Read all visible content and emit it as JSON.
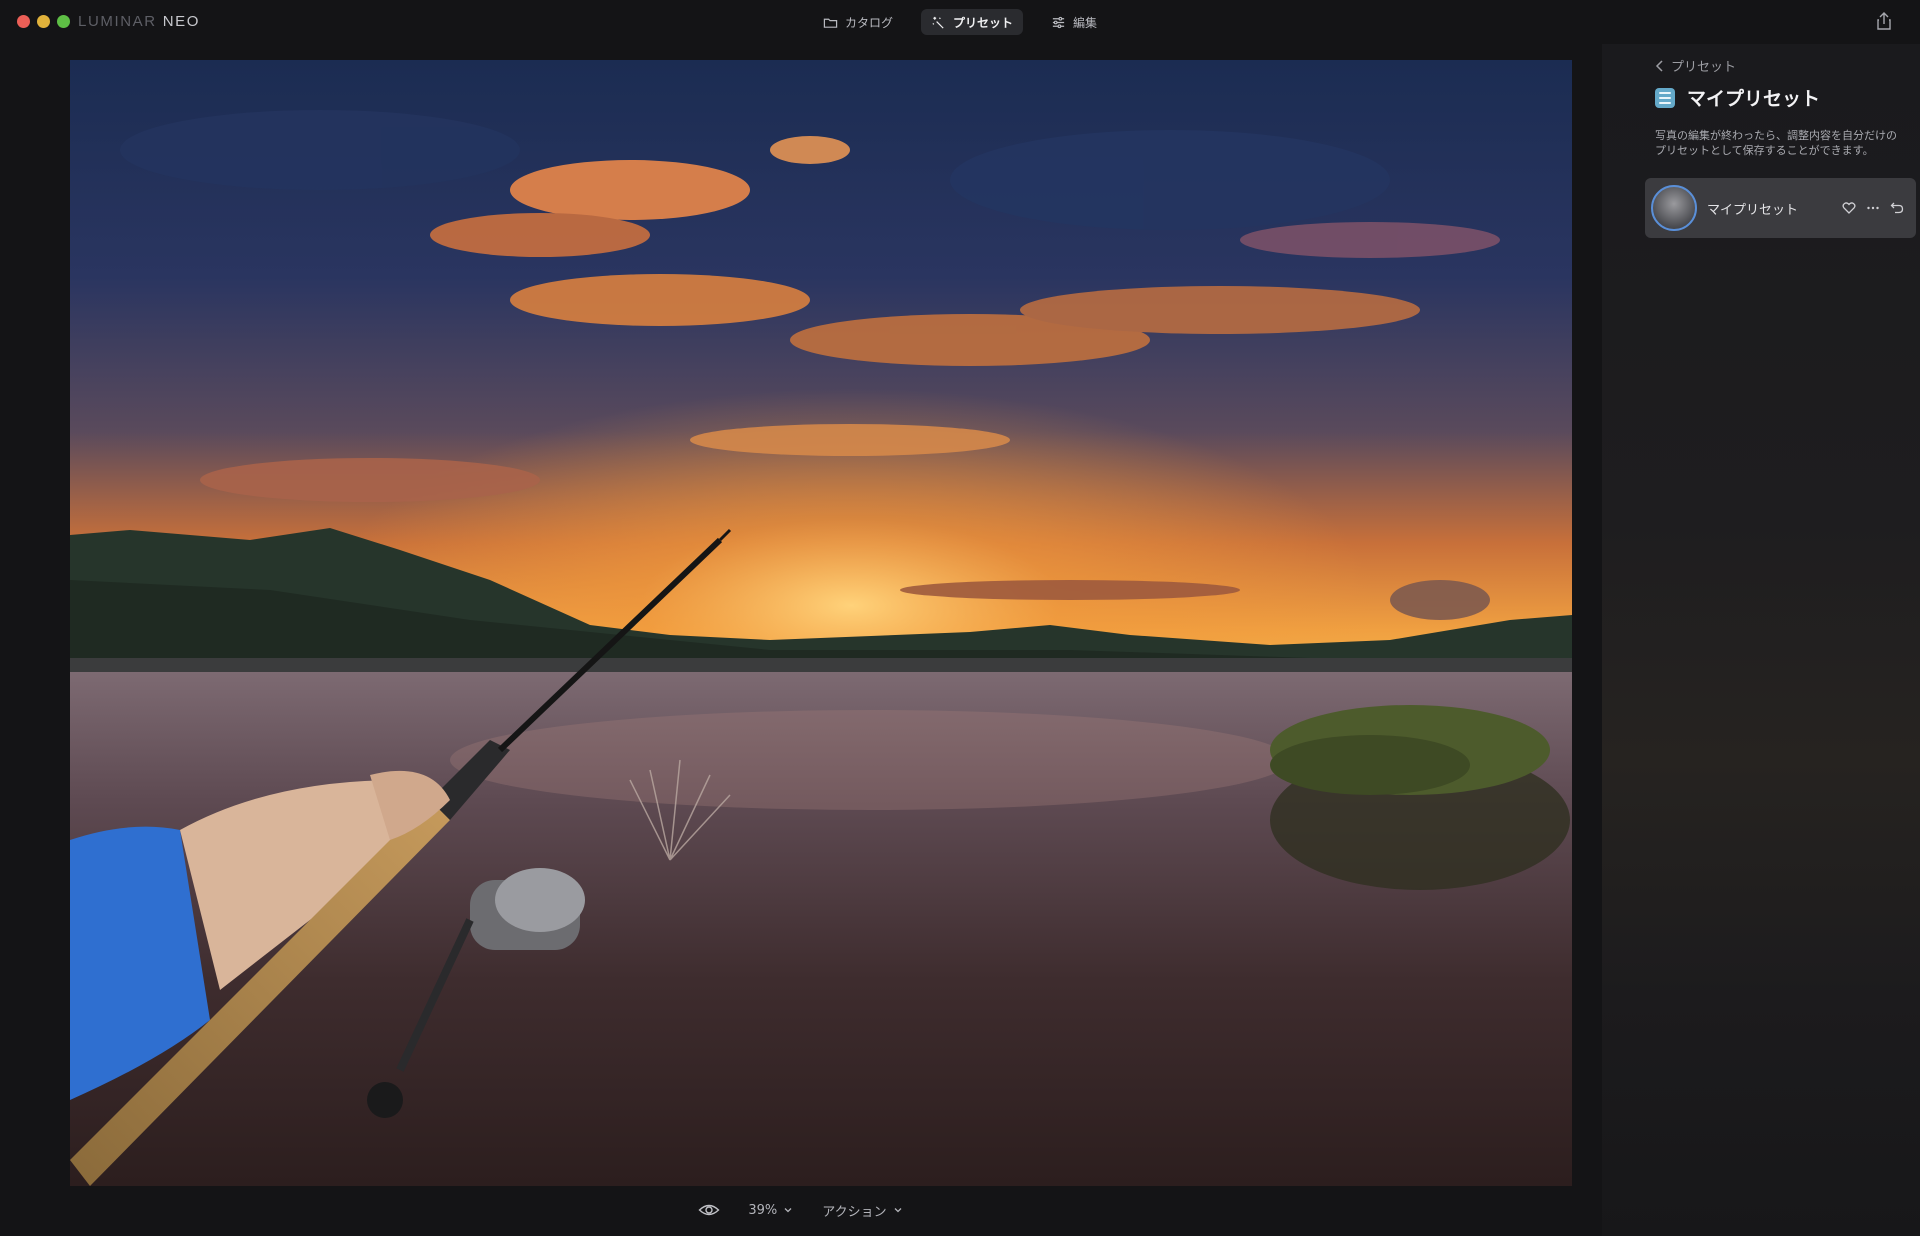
{
  "app": {
    "brand": "LUMINAR",
    "brand_suffix": "NEO"
  },
  "nav": {
    "tabs": [
      {
        "label": "カタログ",
        "icon": "folder-icon",
        "active": false
      },
      {
        "label": "プリセット",
        "icon": "magic-wand-icon",
        "active": true
      },
      {
        "label": "編集",
        "icon": "sliders-icon",
        "active": false
      }
    ]
  },
  "toolbar": {
    "zoom": "39%",
    "actions_label": "アクション"
  },
  "panel": {
    "back_label": "プリセット",
    "title": "マイプリセット",
    "description": "写真の編集が終わったら、調整内容を自分だけのプリセットとして保存することができます。",
    "preset_item": {
      "label": "マイプリセット"
    }
  },
  "colors": {
    "accent": "#5a8fd8",
    "panel_icon": "#64a9c9",
    "card_bg": "#3b3b3f",
    "active_tab_bg": "#2a2b2f"
  }
}
